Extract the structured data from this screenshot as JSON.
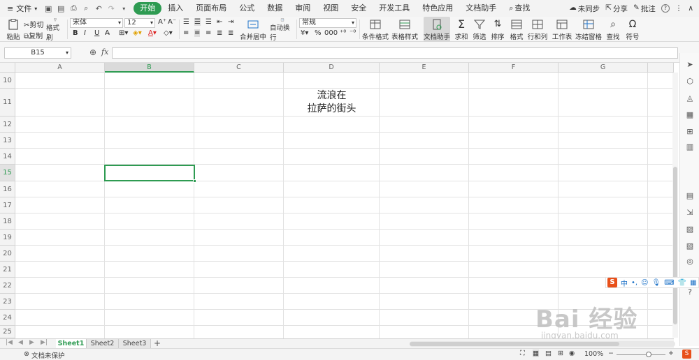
{
  "menubar": {
    "file_label": "文件",
    "tabs": [
      "开始",
      "插入",
      "页面布局",
      "公式",
      "数据",
      "审阅",
      "视图",
      "安全",
      "开发工具",
      "特色应用",
      "文档助手"
    ],
    "active_tab": "开始",
    "search_label": "查找",
    "sync_label": "未同步",
    "share_label": "分享",
    "comment_label": "批注",
    "help_label": "?"
  },
  "ribbon": {
    "paste_label": "粘贴",
    "cut_label": "剪切",
    "copy_label": "复制",
    "format_painter_label": "格式刷",
    "font_name": "宋体",
    "font_size": "12",
    "bold": "B",
    "italic": "I",
    "underline": "U",
    "font_color_label": "A",
    "merge_center_label": "合并居中",
    "wrap_label": "自动换行",
    "number_format": "常规",
    "cond_format_label": "条件格式",
    "table_style_label": "表格样式",
    "doc_helper_label": "文档助手",
    "sum_label": "求和",
    "filter_label": "筛选",
    "sort_label": "排序",
    "format_label": "格式",
    "row_col_label": "行和列",
    "worksheet_label": "工作表",
    "freeze_label": "冻结窗格",
    "find_label": "查找",
    "symbol_label": "符号"
  },
  "formula_bar": {
    "name_box": "B15",
    "fx_label": "fx",
    "content": ""
  },
  "grid": {
    "columns": [
      "A",
      "B",
      "C",
      "D",
      "E",
      "F",
      "G"
    ],
    "selected_column": "B",
    "rows": [
      "10",
      "11",
      "12",
      "13",
      "14",
      "15",
      "16",
      "17",
      "18",
      "19",
      "20",
      "21",
      "22",
      "23",
      "24",
      "25"
    ],
    "selected_row": "15",
    "cell_D11_line1": "流浪在",
    "cell_D11_line2": "拉萨的街头"
  },
  "sheets": {
    "tabs": [
      "Sheet1",
      "Sheet2",
      "Sheet3"
    ],
    "active": "Sheet1",
    "add_label": "+"
  },
  "status": {
    "protect_label": "文档未保护",
    "zoom": "100%"
  },
  "ime": {
    "logo": "S",
    "mode": "中"
  },
  "watermark": {
    "brand": "Bai 经验",
    "url": "jingyan.baidu.com"
  }
}
